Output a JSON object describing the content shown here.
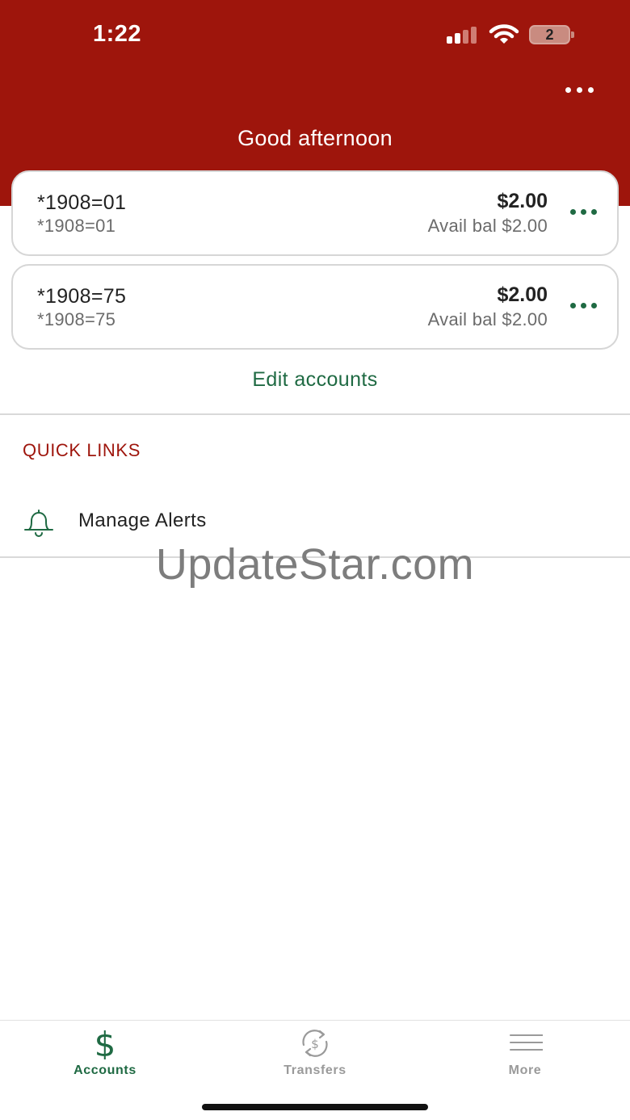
{
  "status_bar": {
    "time": "1:22",
    "battery_level": "2",
    "icons": [
      "signal-icon",
      "wifi-icon",
      "battery-icon"
    ]
  },
  "header": {
    "greeting": "Good afternoon",
    "background_color": "#9e150c",
    "more_icon": "more-horizontal-icon"
  },
  "accounts": [
    {
      "name": "*1908=01",
      "number": "*1908=01",
      "balance": "$2.00",
      "available": "Avail bal $2.00"
    },
    {
      "name": "*1908=75",
      "number": "*1908=75",
      "balance": "$2.00",
      "available": "Avail bal $2.00"
    }
  ],
  "edit_accounts_label": "Edit accounts",
  "quick_links": {
    "title": "QUICK LINKS",
    "items": [
      {
        "label": "Manage Alerts",
        "icon": "bell-icon"
      }
    ]
  },
  "watermark": "UpdateStar.com",
  "tabbar": {
    "tabs": [
      {
        "label": "Accounts",
        "icon": "dollar-icon",
        "active": true
      },
      {
        "label": "Transfers",
        "icon": "transfer-icon",
        "active": false
      },
      {
        "label": "More",
        "icon": "hamburger-menu-icon",
        "active": false
      }
    ]
  },
  "colors": {
    "brand_red": "#9e150c",
    "accent_green": "#1f6a43",
    "muted_gray": "#9a9a9a"
  }
}
